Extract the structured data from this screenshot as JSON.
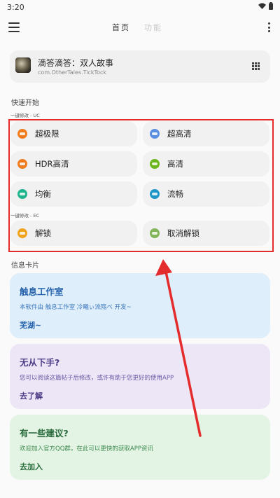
{
  "status_bar": {
    "time": "3:20"
  },
  "app_bar": {
    "tab_home": "首页",
    "tab_functions": "功能"
  },
  "target_app": {
    "name": "滴答滴答：双人故事",
    "package": "com.OtherTales.TickTock"
  },
  "quick_start": {
    "title": "快速开始",
    "group_uc_label": "一键修改 - UC",
    "group_ec_label": "一键修改 - EC",
    "options": [
      {
        "label": "超极限",
        "color": "#f07c1e"
      },
      {
        "label": "超高清",
        "color": "#5d8fe0"
      },
      {
        "label": "HDR高清",
        "color": "#f07c1e"
      },
      {
        "label": "高清",
        "color": "#6ab61c"
      },
      {
        "label": "均衡",
        "color": "#1eb48c"
      },
      {
        "label": "流畅",
        "color": "#1e96c8"
      },
      {
        "label": "解锁",
        "color": "#f0a41e"
      },
      {
        "label": "取消解锁",
        "color": "#82b45a"
      }
    ]
  },
  "info_section": {
    "title": "信息卡片"
  },
  "cards": [
    {
      "title": "触息工作室",
      "desc": "本软件由 触息工作室 冷曦ぃ流殇ベ 开发~",
      "action": "芜湖~"
    },
    {
      "title": "无从下手?",
      "desc": "您可以阅读这篇帖子后修改，或许有助于您更好的使用APP",
      "action": "去了解"
    },
    {
      "title": "有一些建议?",
      "desc": "欢迎加入官方QQ群，在此可以更快的获取APP资讯",
      "action": "去加入"
    }
  ],
  "colors": {
    "highlight": "#e42c2c",
    "arrow": "#e42c2c"
  }
}
